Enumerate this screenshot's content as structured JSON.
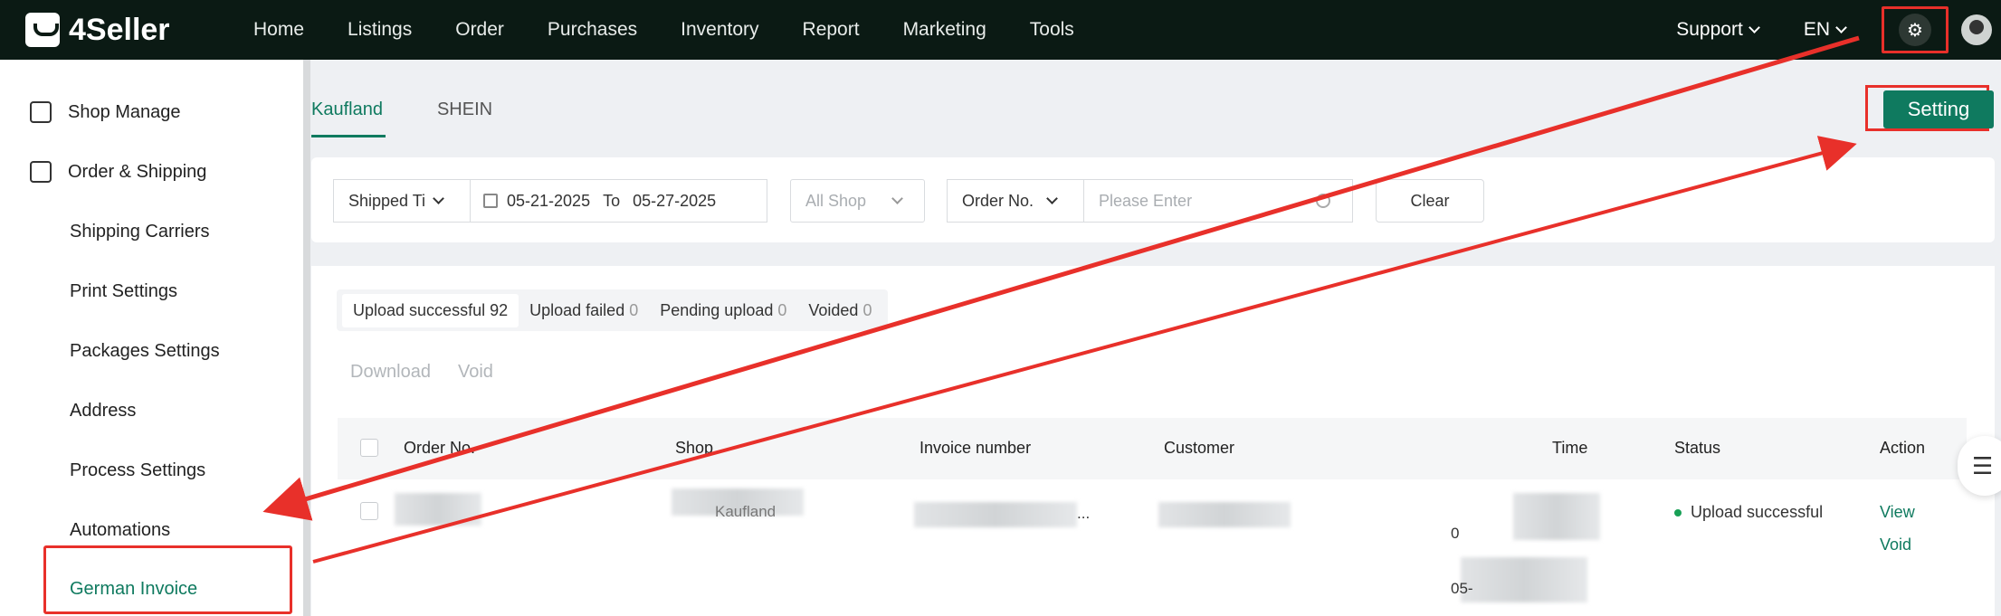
{
  "app": {
    "logo_text": "4Seller"
  },
  "nav": {
    "items": [
      "Home",
      "Listings",
      "Order",
      "Purchases",
      "Inventory",
      "Report",
      "Marketing",
      "Tools"
    ]
  },
  "top_right": {
    "support": "Support",
    "language": "EN"
  },
  "sidebar": {
    "groups": [
      {
        "label": "Shop Manage",
        "icon": "shop-icon"
      },
      {
        "label": "Order & Shipping",
        "icon": "bag-icon"
      }
    ],
    "sub_items": [
      "Shipping Carriers",
      "Print Settings",
      "Packages Settings",
      "Address",
      "Process Settings",
      "Automations",
      "German Invoice"
    ],
    "active": "German Invoice"
  },
  "tabs": {
    "items": [
      "Kaufland",
      "SHEIN"
    ],
    "active": "Kaufland"
  },
  "setting_button": "Setting",
  "filters": {
    "time_type": "Shipped Ti",
    "date_from": "05-21-2025",
    "date_to_label": "To",
    "date_to": "05-27-2025",
    "shop": "All Shop",
    "search_type": "Order No.",
    "search_placeholder": "Please Enter",
    "clear": "Clear"
  },
  "status_tabs": [
    {
      "label": "Upload successful",
      "count": "92"
    },
    {
      "label": "Upload failed",
      "count": "0"
    },
    {
      "label": "Pending upload",
      "count": "0"
    },
    {
      "label": "Voided",
      "count": "0"
    }
  ],
  "bulk_actions": {
    "download": "Download",
    "void": "Void"
  },
  "table": {
    "headers": [
      "Order No.",
      "Shop",
      "Invoice number",
      "Customer",
      "Time",
      "Status",
      "Action"
    ],
    "row": {
      "shop_fragment": "Kaufland",
      "invoice_suffix": "...",
      "time_line1_prefix": "0",
      "time_line2_prefix": "05-",
      "status": "Upload successful",
      "actions": [
        "View",
        "Void"
      ]
    }
  },
  "colors": {
    "brand": "#0f7a5f",
    "annotation": "#e8302a",
    "topbar": "#0b1a14"
  }
}
